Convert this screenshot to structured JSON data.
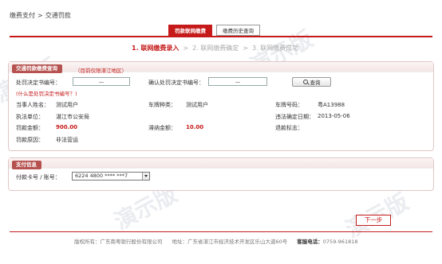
{
  "breadcrumb": {
    "parent": "缴费支付",
    "separator": ">",
    "current": "交通罚款"
  },
  "tabs": [
    {
      "label": "罚款联网缴费",
      "active": true
    },
    {
      "label": "缴费历史查询",
      "active": false
    }
  ],
  "steps": [
    {
      "label": "1. 联网缴费录入",
      "active": true
    },
    {
      "label": "2. 联网缴费确定",
      "active": false
    },
    {
      "label": "3. 联网缴费成功",
      "active": false
    }
  ],
  "step_arrow": ">",
  "penalty_panel": {
    "title": "交通罚款缴费查询",
    "note": "（目前仅限湛江地区）",
    "decision_no_label": "处罚决定书编号：",
    "decision_no_value": "—",
    "confirm_no_label": "确认处罚决定书编号：",
    "confirm_no_value": "—",
    "query_button": "查询",
    "help_link": "(什么是处罚决定书编号？)",
    "fields": {
      "party_name_label": "当事人姓名：",
      "party_name_value": "测试用户",
      "vehicle_type_label": "车牌种类：",
      "vehicle_type_value": "测试用户",
      "plate_no_label": "车牌号码：",
      "plate_no_value": "粤A13988",
      "enforcer_label": "执法单位：",
      "enforcer_value": "湛江市公安局",
      "violation_date_label": "违法确定日期：",
      "violation_date_value": "2013-05-06",
      "fine_label": "罚款金额：",
      "fine_value": "900.00",
      "late_fee_label": "滞纳金额：",
      "late_fee_value": "10.00",
      "refund_label": "退款标志：",
      "refund_value": "",
      "reason_label": "罚款原因：",
      "reason_value": "非法营运"
    }
  },
  "payment_panel": {
    "title": "支付信息",
    "card_label": "付款卡号 / 账号：",
    "card_selected": "6224 4800 **** ***7"
  },
  "next_button": "下一步",
  "footer": {
    "copyright": "版权所有：广东南粤银行股份有限公司",
    "address": "地址：广东省湛江市经济技术开发区乐山大道60号",
    "hotline_label": "客服电话：",
    "hotline": "0759-961818"
  },
  "watermark": "演示版",
  "colors": {
    "accent": "#c61a1a",
    "panel_title_bg": "#b5524f"
  }
}
